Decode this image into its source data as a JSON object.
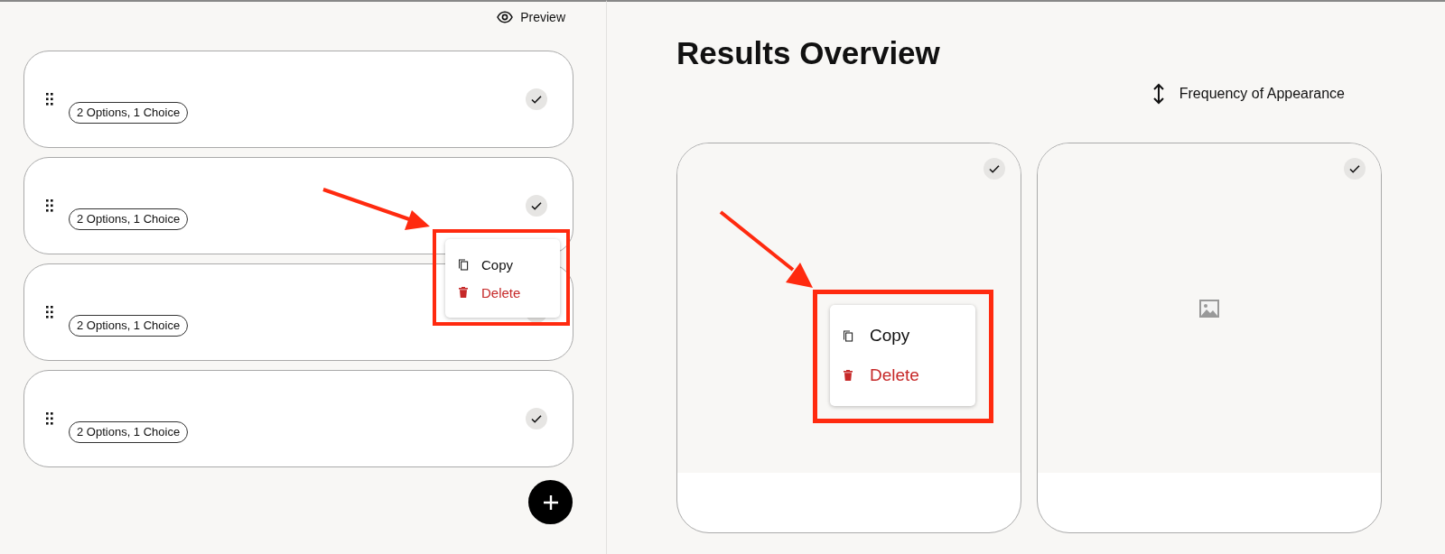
{
  "left_panel": {
    "preview_button": "Preview",
    "questions": [
      {
        "badge": "2 Options, 1 Choice",
        "checked": true
      },
      {
        "badge": "2 Options, 1 Choice",
        "checked": true
      },
      {
        "badge": "2 Options, 1 Choice",
        "checked": true
      },
      {
        "badge": "2 Options, 1 Choice",
        "checked": true
      }
    ],
    "context_menu": {
      "highlighted": true,
      "pointer_arrow": true,
      "items": [
        {
          "kind": "copy",
          "label": "Copy"
        },
        {
          "kind": "delete",
          "label": "Delete"
        }
      ]
    }
  },
  "right_panel": {
    "title": "Results Overview",
    "sort_label": "Frequency of Appearance",
    "results": [
      {
        "checked": true,
        "has_image": false
      },
      {
        "checked": true,
        "has_image": true
      }
    ],
    "context_menu": {
      "highlighted": true,
      "pointer_arrow": true,
      "items": [
        {
          "kind": "copy",
          "label": "Copy"
        },
        {
          "kind": "delete",
          "label": "Delete"
        }
      ]
    }
  }
}
